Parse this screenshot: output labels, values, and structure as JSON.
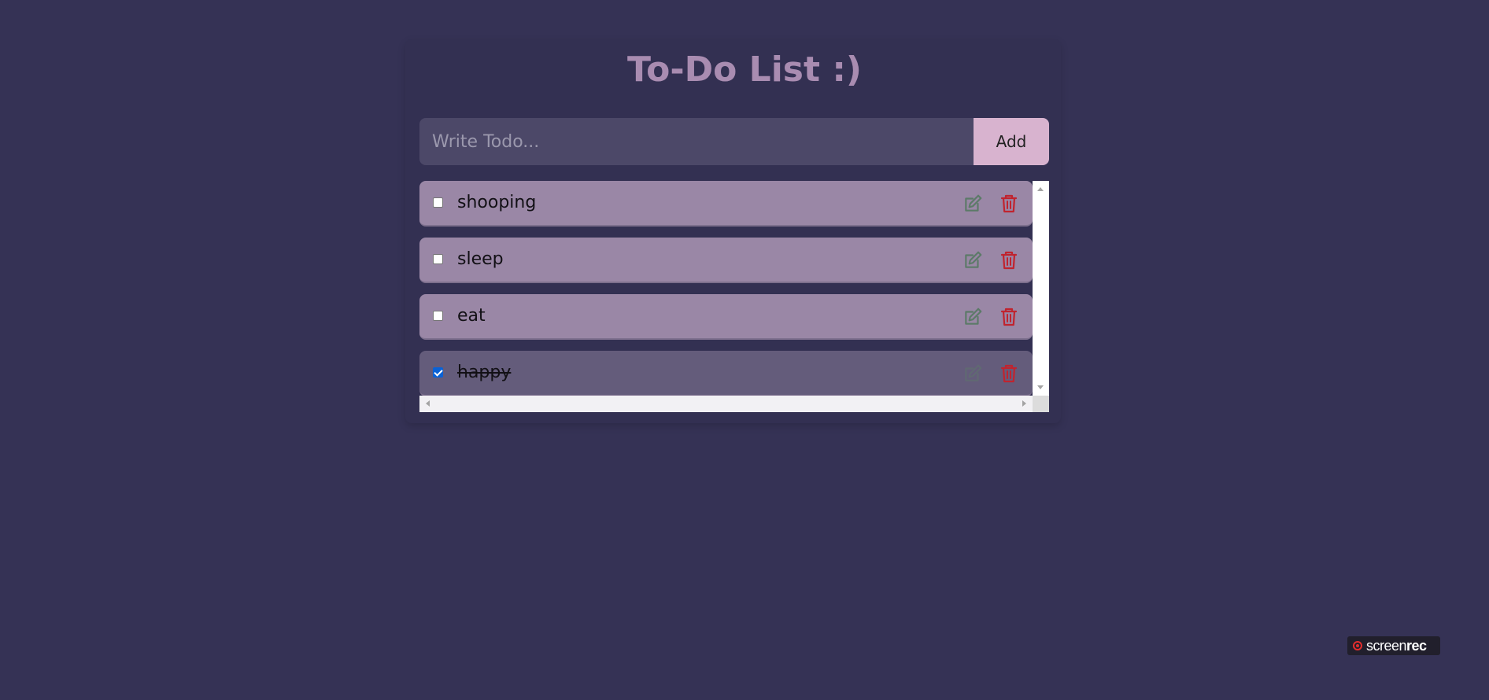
{
  "app": {
    "title": "To-Do List :)"
  },
  "input": {
    "placeholder": "Write Todo...",
    "value": "",
    "add_label": "Add"
  },
  "todos": [
    {
      "text": "shooping",
      "done": false
    },
    {
      "text": "sleep",
      "done": false
    },
    {
      "text": "eat",
      "done": false
    },
    {
      "text": "happy",
      "done": true
    }
  ],
  "icons": {
    "edit": "edit-icon",
    "delete": "trash-icon",
    "edit_color": "#5c7a68",
    "delete_color": "#c0242f"
  },
  "colors": {
    "background": "#353255",
    "title": "#a98cb1",
    "item": "#9a87a6",
    "item_done": "#645c7b",
    "add_button": "#d8b3cf"
  },
  "watermark": {
    "prefix": "screen",
    "suffix": "rec"
  }
}
